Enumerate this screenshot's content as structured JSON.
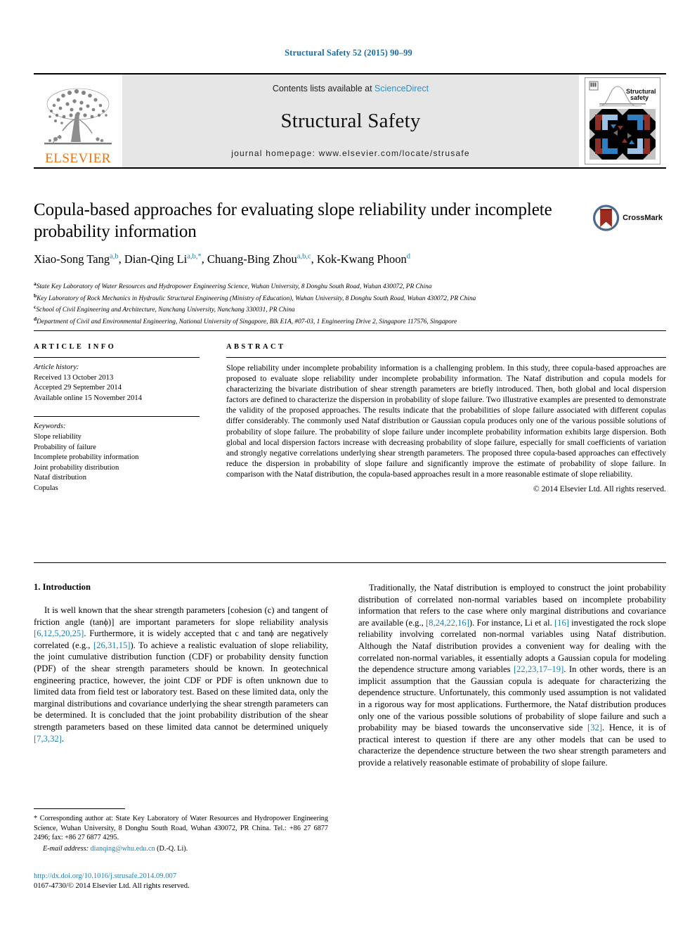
{
  "running_head": "Structural Safety 52 (2015) 90–99",
  "masthead": {
    "publisher_name": "ELSEVIER",
    "contents_prefix": "Contents lists available at ",
    "sciencedirect": "ScienceDirect",
    "journal_name": "Structural Safety",
    "homepage": "journal homepage: www.elsevier.com/locate/strusafe",
    "cover_title_line1": "Structural",
    "cover_title_line2": "safety",
    "colors": {
      "link": "#2196d8",
      "banner_bg": "#e6e6e6",
      "elsevier_orange": "#E87511",
      "cover_blue": "#2e7fc1",
      "cover_lightblue": "#9cc3e5",
      "cover_red": "#8c2f26",
      "cover_gray": "#bdbdbd"
    }
  },
  "article": {
    "title": "Copula-based approaches for evaluating slope reliability under incomplete probability information",
    "authors": [
      {
        "name": "Xiao-Song Tang",
        "sup": "a,b",
        "sep": ", "
      },
      {
        "name": "Dian-Qing Li",
        "sup": "a,b,",
        "star": "*",
        "sep": ", "
      },
      {
        "name": "Chuang-Bing Zhou",
        "sup": "a,b,c",
        "sep": ", "
      },
      {
        "name": "Kok-Kwang Phoon",
        "sup": "d",
        "sep": ""
      }
    ],
    "affiliations": [
      {
        "marker": "a",
        "text": "State Key Laboratory of Water Resources and Hydropower Engineering Science, Wuhan University, 8 Donghu South Road, Wuhan 430072, PR China"
      },
      {
        "marker": "b",
        "text": "Key Laboratory of Rock Mechanics in Hydraulic Structural Engineering (Ministry of Education), Wuhan University, 8 Donghu South Road, Wuhan 430072, PR China"
      },
      {
        "marker": "c",
        "text": "School of Civil Engineering and Architecture, Nanchang University, Nanchang 330031, PR China"
      },
      {
        "marker": "d",
        "text": "Department of Civil and Environmental Engineering, National University of Singapore, Blk E1A, #07-03, 1 Engineering Drive 2, Singapore 117576, Singapore"
      }
    ],
    "crossmark_label": "CrossMark"
  },
  "article_info": {
    "heading": "ARTICLE INFO",
    "history_label": "Article history:",
    "history": [
      "Received 13 October 2013",
      "Accepted 29 September 2014",
      "Available online 15 November 2014"
    ],
    "keywords_label": "Keywords:",
    "keywords": [
      "Slope reliability",
      "Probability of failure",
      "Incomplete probability information",
      "Joint probability distribution",
      "Nataf distribution",
      "Copulas"
    ]
  },
  "abstract": {
    "heading": "ABSTRACT",
    "text": "Slope reliability under incomplete probability information is a challenging problem. In this study, three copula-based approaches are proposed to evaluate slope reliability under incomplete probability information. The Nataf distribution and copula models for characterizing the bivariate distribution of shear strength parameters are briefly introduced. Then, both global and local dispersion factors are defined to characterize the dispersion in probability of slope failure. Two illustrative examples are presented to demonstrate the validity of the proposed approaches. The results indicate that the probabilities of slope failure associated with different copulas differ considerably. The commonly used Nataf distribution or Gaussian copula produces only one of the various possible solutions of probability of slope failure. The probability of slope failure under incomplete probability information exhibits large dispersion. Both global and local dispersion factors increase with decreasing probability of slope failure, especially for small coefficients of variation and strongly negative correlations underlying shear strength parameters. The proposed three copula-based approaches can effectively reduce the dispersion in probability of slope failure and significantly improve the estimate of probability of slope failure. In comparison with the Nataf distribution, the copula-based approaches result in a more reasonable estimate of slope reliability.",
    "copyright": "© 2014 Elsevier Ltd. All rights reserved."
  },
  "introduction": {
    "heading": "1. Introduction",
    "left_paragraph_parts": [
      {
        "t": "It is well known that the shear strength parameters [cohesion (c) and tangent of friction angle (tanϕ)] are important parameters for slope reliability analysis "
      },
      {
        "t": "[6,12,5,20,25]",
        "ref": true
      },
      {
        "t": ". Furthermore, it is widely accepted that c and tanϕ are negatively correlated (e.g., "
      },
      {
        "t": "[26,31,15]",
        "ref": true
      },
      {
        "t": "). To achieve a realistic evaluation of slope reliability, the joint cumulative distribution function (CDF) or probability density function (PDF) of the shear strength parameters should be known. In geotechnical engineering practice, however, the joint CDF or PDF is often unknown due to limited data from field test or laboratory test. Based on these limited data, only the marginal distributions and covariance underlying the shear strength parameters can be determined. It is concluded that the joint probability distribution of the shear strength parameters based on these limited data cannot be determined uniquely "
      },
      {
        "t": "[7,3,32]",
        "ref": true
      },
      {
        "t": "."
      }
    ],
    "right_paragraph_parts": [
      {
        "t": "Traditionally, the Nataf distribution is employed to construct the joint probability distribution of correlated non-normal variables based on incomplete probability information that refers to the case where only marginal distributions and covariance are available (e.g., "
      },
      {
        "t": "[8,24,22,16]",
        "ref": true
      },
      {
        "t": "). For instance, Li et al. "
      },
      {
        "t": "[16]",
        "ref": true
      },
      {
        "t": " investigated the rock slope reliability involving correlated non-normal variables using Nataf distribution. Although the Nataf distribution provides a convenient way for dealing with the correlated non-normal variables, it essentially adopts a Gaussian copula for modeling the dependence structure among variables "
      },
      {
        "t": "[22,23,17–19]",
        "ref": true
      },
      {
        "t": ". In other words, there is an implicit assumption that the Gaussian copula is adequate for characterizing the dependence structure. Unfortunately, this commonly used assumption is not validated in a rigorous way for most applications. Furthermore, the Nataf distribution produces only one of the various possible solutions of probability of slope failure and such a probability may be biased towards the unconservative side "
      },
      {
        "t": "[32]",
        "ref": true
      },
      {
        "t": ". Hence, it is of practical interest to question if there are any other models that can be used to characterize the dependence structure between the two shear strength parameters and provide a relatively reasonable estimate of probability of slope failure."
      }
    ]
  },
  "footnote": {
    "corresponding": "* Corresponding author at: State Key Laboratory of Water Resources and Hydropower Engineering Science, Wuhan University, 8 Donghu South Road, Wuhan 430072, PR China. Tel.: +86 27 6877 2496; fax: +86 27 6877 4295.",
    "email_label": "E-mail address:",
    "email": "dianqing@whu.edu.cn",
    "email_owner": "(D.-Q. Li).",
    "doi": "http://dx.doi.org/10.1016/j.strusafe.2014.09.007",
    "issn_line": "0167-4730/© 2014 Elsevier Ltd. All rights reserved."
  }
}
